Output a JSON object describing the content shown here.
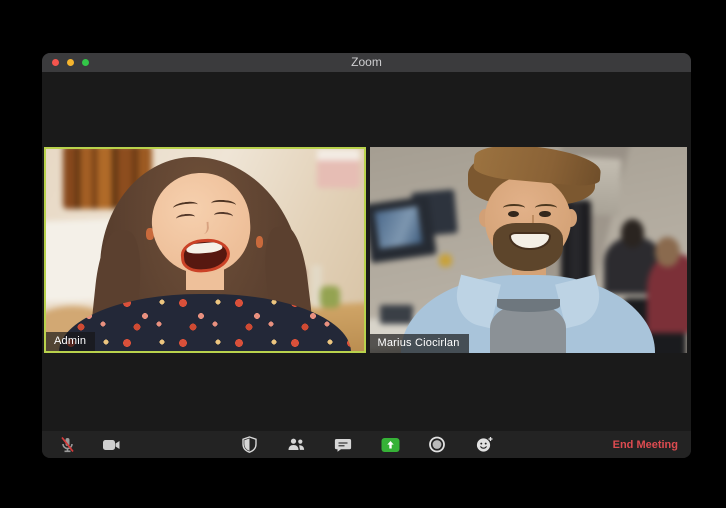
{
  "window": {
    "title": "Zoom",
    "traffic_lights": [
      "close",
      "minimize",
      "zoom"
    ]
  },
  "participants": [
    {
      "name": "Admin",
      "active_speaker": true,
      "border_color": "#b9d24c"
    },
    {
      "name": "Marius Ciocirlan",
      "active_speaker": false
    }
  ],
  "toolbar": {
    "items": [
      {
        "id": "mute",
        "icon": "microphone-muted-icon",
        "state": "muted"
      },
      {
        "id": "video",
        "icon": "video-camera-icon",
        "state": "on"
      },
      {
        "id": "security",
        "icon": "shield-icon"
      },
      {
        "id": "participants",
        "icon": "participants-icon"
      },
      {
        "id": "chat",
        "icon": "chat-bubble-icon"
      },
      {
        "id": "share-screen",
        "icon": "share-screen-icon",
        "accent": "#36b237"
      },
      {
        "id": "record",
        "icon": "record-icon"
      },
      {
        "id": "reactions",
        "icon": "reactions-icon"
      }
    ],
    "end_meeting_label": "End Meeting"
  },
  "colors": {
    "window_bg": "#1a1a1a",
    "titlebar_bg": "#3b3b3d",
    "toolbar_bg": "#232323",
    "active_speaker_border": "#b9d24c",
    "share_button_green": "#36b237",
    "end_meeting_red": "#dd4b50",
    "mute_slash_red": "#d83a3a",
    "traffic_red": "#f5554e",
    "traffic_yellow": "#f6b52e",
    "traffic_green": "#33c748"
  }
}
